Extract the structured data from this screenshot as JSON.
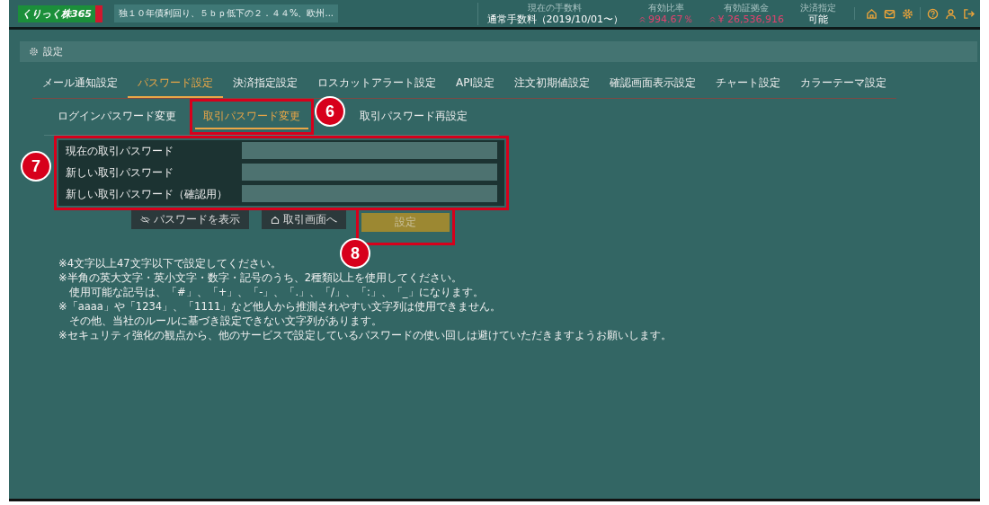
{
  "header": {
    "logo": "くりっく株365",
    "ticker": "独１０年債利回り、５ｂｐ低下の２．４４%、欧州...",
    "stats": [
      {
        "label": "現在の手数料",
        "value": "通常手数料（2019/10/01〜）",
        "up": false
      },
      {
        "label": "有効比率",
        "value": "994.67％",
        "up": true
      },
      {
        "label": "有効証拠金",
        "value": "¥ 26,536,916",
        "up": true
      },
      {
        "label": "決済指定",
        "value": "可能",
        "up": false
      }
    ]
  },
  "panel": {
    "title": "設定"
  },
  "tabs": [
    {
      "label": "メール通知設定",
      "selected": false
    },
    {
      "label": "パスワード設定",
      "selected": true
    },
    {
      "label": "決済指定設定",
      "selected": false
    },
    {
      "label": "ロスカットアラート設定",
      "selected": false
    },
    {
      "label": "API設定",
      "selected": false
    },
    {
      "label": "注文初期値設定",
      "selected": false
    },
    {
      "label": "確認画面表示設定",
      "selected": false
    },
    {
      "label": "チャート設定",
      "selected": false
    },
    {
      "label": "カラーテーマ設定",
      "selected": false
    }
  ],
  "subtabs": [
    {
      "label": "ログインパスワード変更",
      "selected": false
    },
    {
      "label": "取引パスワード変更",
      "selected": true,
      "callout": "6"
    },
    {
      "label": "取引パスワード再設定",
      "selected": false
    }
  ],
  "form": {
    "callout": "7",
    "fields": [
      {
        "label": "現在の取引パスワード"
      },
      {
        "label": "新しい取引パスワード"
      },
      {
        "label": "新しい取引パスワード（確認用）"
      }
    ]
  },
  "buttons": [
    {
      "kind": "show",
      "label": "パスワードを表示",
      "disabled": false
    },
    {
      "kind": "home",
      "label": "取引画面へ",
      "disabled": false
    },
    {
      "kind": "submit",
      "label": "設定",
      "disabled": true,
      "callout": "8"
    }
  ],
  "notes": [
    "※4文字以上47文字以下で設定してください。",
    "※半角の英大文字・英小文字・数字・記号のうち、2種類以上を使用してください。",
    "　使用可能な記号は、「#」、「+」、「-」、「.」、「/」、「:」、「_」になります。",
    "※「aaaa」や「1234」、「1111」など他人から推測されやすい文字列は使用できません。",
    "　その他、当社のルールに基づき設定できない文字列があります。",
    "※セキュリティ強化の観点から、他のサービスで設定しているパスワードの使い回しは避けていただきますようお願いします。"
  ]
}
